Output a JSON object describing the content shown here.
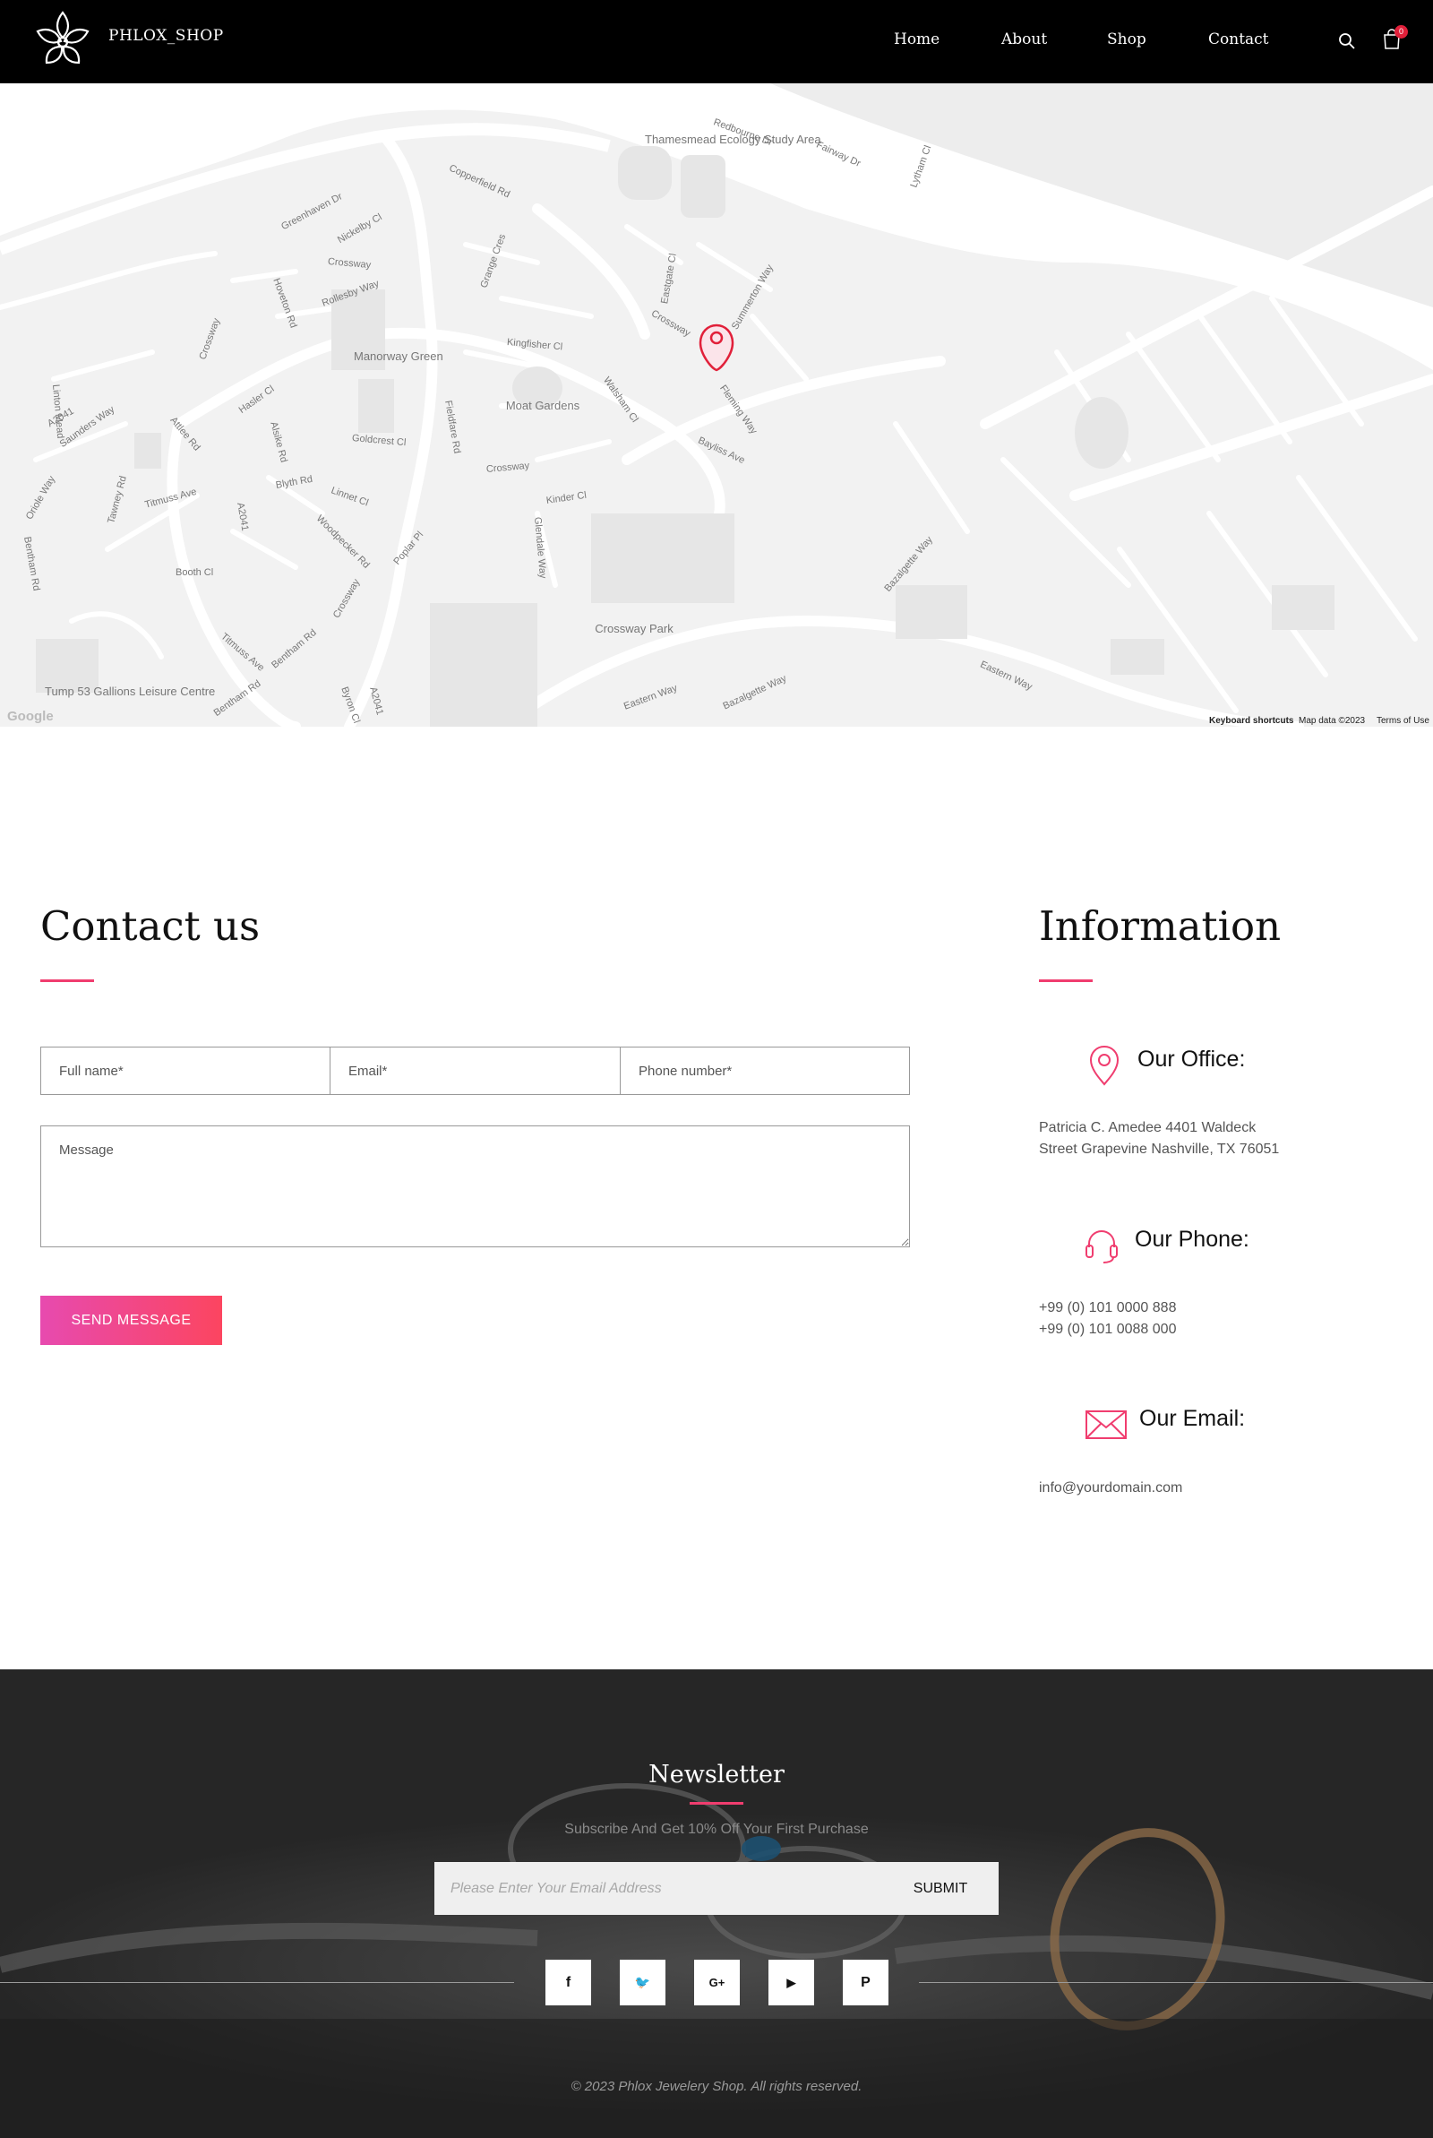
{
  "header": {
    "brand": "PHLOX_SHOP",
    "nav": [
      {
        "label": "Home"
      },
      {
        "label": "About"
      },
      {
        "label": "Shop"
      },
      {
        "label": "Contact"
      }
    ],
    "cart_count": "0",
    "icons": {
      "logo": "flower-logo-icon",
      "search": "search-icon",
      "cart": "shopping-bag-icon"
    }
  },
  "map": {
    "labels": [
      "Redbourne Dr",
      "Fairway Dr",
      "Lytham Cl",
      "Copperfield Rd",
      "Greenhaven Dr",
      "Nickelby Cl",
      "Crossway",
      "Grange Cres",
      "Eastgate Cl",
      "Summerton Way",
      "Hoveton Rd",
      "Rollesby Way",
      "Crossway",
      "Kingfisher Cl",
      "Crossway",
      "Walsham Cl",
      "Fleming Way",
      "Linton Mead",
      "A2041",
      "Saunders Way",
      "Attlee Rd",
      "Hasler Cl",
      "Alsike Rd",
      "Fieldfare Rd",
      "Goldcrest Cl",
      "Bayliss Ave",
      "Crossway",
      "Tawney Rd",
      "Oriole Way",
      "Titmuss Ave",
      "Blyth Rd",
      "Linnet Cl",
      "A2041",
      "Kinder Cl",
      "Woodpecker Rd",
      "Poplar Pl",
      "Glendale Way",
      "Bentham Rd",
      "Booth Cl",
      "Crossway",
      "Bazalgette Way",
      "Titmuss Ave",
      "Bentham Rd",
      "Eastern Way",
      "Bazalgette Way",
      "Eastern Way",
      "A2041",
      "Byron Cl",
      "Bentham Rd"
    ],
    "areas": [
      "Thamesmead Ecology Study Area",
      "Manorway Green",
      "Moat Gardens",
      "Crossway Park",
      "Tump 53 Gallions Leisure Centre"
    ],
    "google": "Google",
    "attribution": [
      "Keyboard shortcuts",
      "Map data ©2023",
      "Terms of Use"
    ],
    "pin_icon": "map-pin-icon"
  },
  "contact": {
    "title": "Contact us",
    "fields": {
      "full_name": "Full name*",
      "email": "Email*",
      "phone": "Phone number*",
      "message": "Message"
    },
    "send_label": "SEND MESSAGE",
    "accent": "#f03d6f"
  },
  "information": {
    "title": "Information",
    "office": {
      "title": "Our Office:",
      "lines": [
        "Patricia C. Amedee 4401 Waldeck",
        "Street Grapevine Nashville, TX 76051"
      ],
      "icon": "location-pin-icon"
    },
    "phone": {
      "title": "Our Phone:",
      "lines": [
        "+99 (0) 101 0000 888",
        "+99 (0) 101 0088 000"
      ],
      "icon": "headset-icon"
    },
    "email": {
      "title": "Our Email:",
      "lines": [
        "info@yourdomain.com"
      ],
      "icon": "envelope-icon"
    }
  },
  "footer": {
    "newsletter_title": "Newsletter",
    "newsletter_sub": "Subscribe And Get 10% Off Your First Purchase",
    "email_placeholder": "Please Enter Your Email Address",
    "submit_label": "SUBMIT",
    "social": [
      {
        "glyph": "f",
        "icon": "facebook-icon"
      },
      {
        "glyph": "🐦",
        "icon": "twitter-icon"
      },
      {
        "glyph": "G+",
        "icon": "google-plus-icon"
      },
      {
        "glyph": "▶",
        "icon": "youtube-icon"
      },
      {
        "glyph": "P",
        "icon": "pinterest-icon"
      }
    ],
    "copyright": "© 2023 Phlox Jewelery Shop. All rights reserved."
  }
}
